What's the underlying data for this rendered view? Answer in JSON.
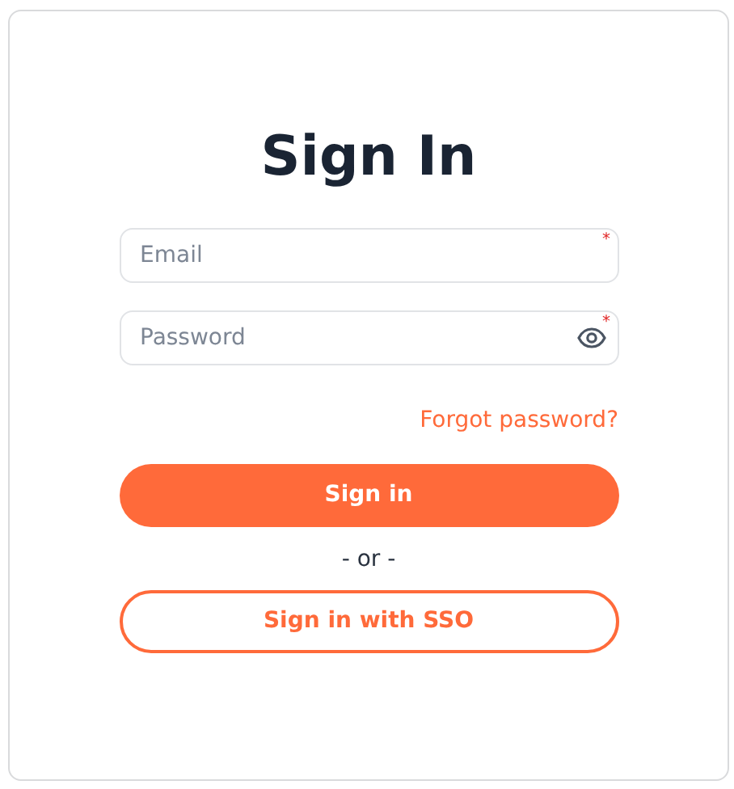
{
  "title": "Sign In",
  "fields": [
    {
      "kind": "email",
      "placeholder": "Email",
      "required_mark": "*"
    },
    {
      "kind": "password",
      "placeholder": "Password",
      "required_mark": "*"
    }
  ],
  "forgot_link": "Forgot password?",
  "primary_button": "Sign in",
  "separator": "- or -",
  "sso_button": "Sign in with SSO"
}
